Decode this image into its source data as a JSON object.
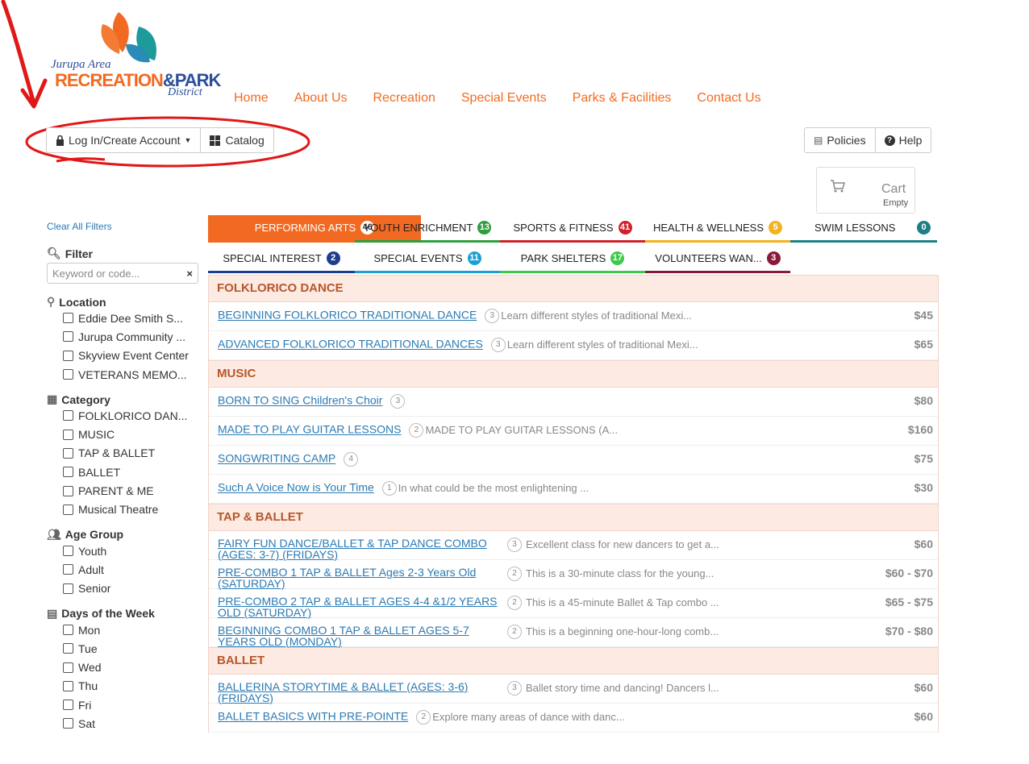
{
  "logo": {
    "line1": "Jurupa Area",
    "line2a": "RECREATION",
    "line2b": "PARK",
    "amp": "&",
    "line3": "District"
  },
  "nav": [
    "Home",
    "About Us",
    "Recreation",
    "Special Events",
    "Parks & Facilities",
    "Contact Us"
  ],
  "toolbar": {
    "login": "Log In/Create Account",
    "catalog": "Catalog",
    "policies": "Policies",
    "help": "Help"
  },
  "cart": {
    "label": "Cart",
    "status": "Empty"
  },
  "sidebar": {
    "clear": "Clear All Filters",
    "filter_title": "Filter",
    "keyword_placeholder": "Keyword or code...",
    "location_title": "Location",
    "locations": [
      "Eddie Dee Smith S...",
      "Jurupa Community ...",
      "Skyview Event Center",
      "VETERANS MEMO..."
    ],
    "category_title": "Category",
    "categories": [
      "FOLKLORICO DAN...",
      "MUSIC",
      "TAP & BALLET",
      "BALLET",
      "PARENT & ME",
      "Musical Theatre"
    ],
    "age_title": "Age Group",
    "ages": [
      "Youth",
      "Adult",
      "Senior"
    ],
    "days_title": "Days of the Week",
    "days": [
      "Mon",
      "Tue",
      "Wed",
      "Thu",
      "Fri",
      "Sat"
    ]
  },
  "tabs": [
    {
      "label": "PERFORMING ARTS",
      "count": "46",
      "color": "#f26a21"
    },
    {
      "label": "YOUTH ENRICHMENT",
      "count": "13",
      "color": "#2e9e3e"
    },
    {
      "label": "SPORTS & FITNESS",
      "count": "41",
      "color": "#d0202a"
    },
    {
      "label": "HEALTH & WELLNESS",
      "count": "5",
      "color": "#f2b31d"
    },
    {
      "label": "SWIM LESSONS",
      "count": "0",
      "color": "#1d7f86"
    },
    {
      "label": "SPECIAL INTEREST",
      "count": "2",
      "color": "#1f3d8f"
    },
    {
      "label": "SPECIAL EVENTS",
      "count": "11",
      "color": "#1ca0d4"
    },
    {
      "label": "PARK SHELTERS",
      "count": "17",
      "color": "#3ec94a"
    },
    {
      "label": "VOLUNTEERS WAN...",
      "count": "3",
      "color": "#8a1a3a"
    }
  ],
  "sections": [
    {
      "title": "FOLKLORICO DANCE",
      "rows": [
        {
          "name": "BEGINNING FOLKLORICO TRADITIONAL DANCE",
          "n": "3",
          "desc": "Learn different styles of traditional Mexi...",
          "price": "$45"
        },
        {
          "name": "ADVANCED FOLKLORICO TRADITIONAL DANCES",
          "n": "3",
          "desc": "Learn different styles of traditional Mexi...",
          "price": "$65"
        }
      ]
    },
    {
      "title": "MUSIC",
      "rows": [
        {
          "name": "BORN TO SING Children's Choir",
          "n": "3",
          "desc": "",
          "price": "$80"
        },
        {
          "name": "MADE TO PLAY GUITAR LESSONS",
          "n": "2",
          "desc": "MADE TO PLAY GUITAR LESSONS (A...",
          "price": "$160"
        },
        {
          "name": "SONGWRITING CAMP",
          "n": "4",
          "desc": "",
          "price": "$75"
        },
        {
          "name": "Such A Voice Now is Your Time",
          "n": "1",
          "desc": "In what could be the most enlightening ...",
          "price": "$30"
        }
      ]
    },
    {
      "title": "TAP & BALLET",
      "rows": [
        {
          "name": "FAIRY FUN DANCE/BALLET & TAP DANCE COMBO (AGES: 3-7) (FRIDAYS)",
          "n": "3",
          "desc": "Excellent class for new dancers to get a...",
          "price": "$60"
        },
        {
          "name": "PRE-COMBO 1 TAP & BALLET Ages 2-3 Years Old (SATURDAY)",
          "n": "2",
          "desc": "This is a 30-minute class for the young...",
          "price": "$60 - $70"
        },
        {
          "name": "PRE-COMBO 2 TAP & BALLET AGES 4-4 &1/2 YEARS OLD (SATURDAY)",
          "n": "2",
          "desc": "This is a 45-minute Ballet & Tap combo ...",
          "price": "$65 - $75"
        },
        {
          "name": "BEGINNING COMBO 1 TAP & BALLET AGES 5-7 YEARS OLD (MONDAY)",
          "n": "2",
          "desc": "This is a beginning one-hour-long comb...",
          "price": "$70 - $80"
        }
      ]
    },
    {
      "title": "BALLET",
      "rows": [
        {
          "name": "BALLERINA STORYTIME & BALLET (AGES: 3-6) (FRIDAYS)",
          "n": "3",
          "desc": "Ballet story time and dancing! Dancers l...",
          "price": "$60"
        },
        {
          "name": "BALLET BASICS WITH PRE-POINTE",
          "n": "2",
          "desc": "Explore many areas of dance with danc...",
          "price": "$60"
        }
      ]
    }
  ]
}
